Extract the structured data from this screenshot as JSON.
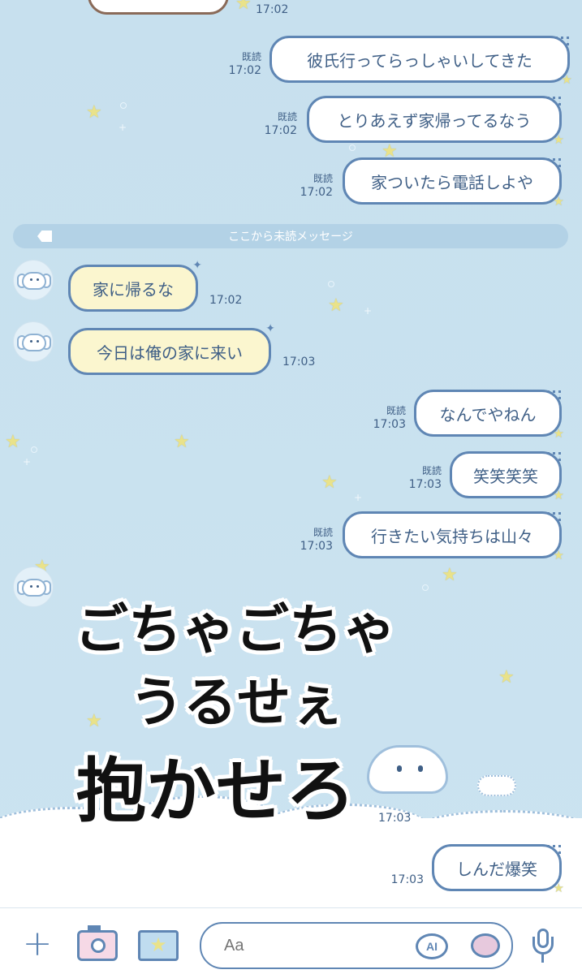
{
  "chat": {
    "top_partial_time": "17:02",
    "unread_divider": "ここから未読メッセージ",
    "messages": [
      {
        "dir": "out",
        "text": "彼氏行ってらっしゃいしてきた",
        "read": "既読",
        "time": "17:02"
      },
      {
        "dir": "out",
        "text": "とりあえず家帰ってるなう",
        "read": "既読",
        "time": "17:02"
      },
      {
        "dir": "out",
        "text": "家ついたら電話しよや",
        "read": "既読",
        "time": "17:02"
      },
      {
        "dir": "in",
        "text": "家に帰るな",
        "time": "17:02"
      },
      {
        "dir": "in",
        "text": "今日は俺の家に来い",
        "time": "17:03"
      },
      {
        "dir": "out",
        "text": "なんでやねん",
        "read": "既読",
        "time": "17:03"
      },
      {
        "dir": "out",
        "text": "笑笑笑笑",
        "read": "既読",
        "time": "17:03"
      },
      {
        "dir": "out",
        "text": "行きたい気持ちは山々",
        "read": "既読",
        "time": "17:03"
      },
      {
        "dir": "in",
        "text": "",
        "time": "17:03"
      },
      {
        "dir": "out",
        "text": "しんだ爆笑",
        "time": "17:03"
      }
    ]
  },
  "overlay": {
    "line1": "ごちゃごちゃ",
    "line2": "うるせぇ",
    "line3": "抱かせろ"
  },
  "input_bar": {
    "placeholder": "Aa",
    "ai_label": "AI",
    "icons": [
      "plus-icon",
      "camera-icon",
      "image-icon",
      "ai-icon",
      "sticker-icon",
      "microphone-icon"
    ]
  },
  "colors": {
    "background": "#c9e1ee",
    "bubble_border": "#5f86b4",
    "incoming_bubble": "#fbf6cf",
    "outgoing_bubble": "#ffffff",
    "text": "#3f5f86",
    "star": "#e9e28a"
  }
}
